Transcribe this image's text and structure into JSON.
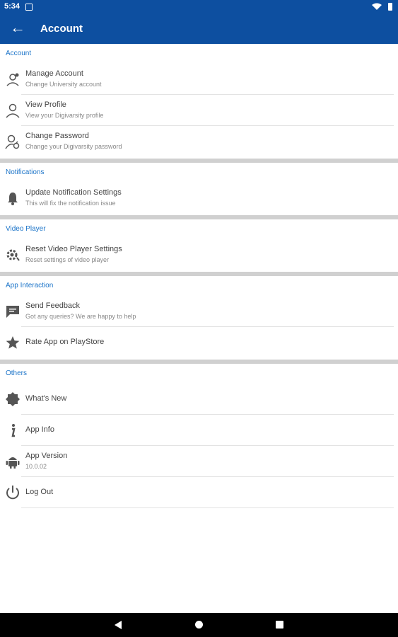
{
  "status_bar": {
    "time": "5:34"
  },
  "app_bar": {
    "title": "Account"
  },
  "sections": {
    "account": {
      "header": "Account",
      "items": [
        {
          "title": "Manage Account",
          "subtitle": "Change University account"
        },
        {
          "title": "View Profile",
          "subtitle": "View your Digivarsity profile"
        },
        {
          "title": "Change Password",
          "subtitle": "Change your Digivarsity password"
        }
      ]
    },
    "notifications": {
      "header": "Notifications",
      "items": [
        {
          "title": "Update Notification Settings",
          "subtitle": "This will fix the notification issue"
        }
      ]
    },
    "video_player": {
      "header": "Video Player",
      "items": [
        {
          "title": "Reset Video Player Settings",
          "subtitle": "Reset settings of video player"
        }
      ]
    },
    "app_interaction": {
      "header": "App Interaction",
      "items": [
        {
          "title": "Send Feedback",
          "subtitle": "Got any queries? We are happy to help"
        },
        {
          "title": "Rate App on PlayStore"
        }
      ]
    },
    "others": {
      "header": "Others",
      "items": [
        {
          "title": "What's New"
        },
        {
          "title": "App Info"
        },
        {
          "title": "App Version",
          "subtitle": "10.0.02"
        },
        {
          "title": "Log Out"
        }
      ]
    }
  },
  "colors": {
    "primary": "#0d4fa0",
    "accent": "#1a73c8",
    "icon": "#555555",
    "separator": "#d0d0d0"
  },
  "icons": [
    "back-arrow",
    "manage-account",
    "person",
    "change-password",
    "bell",
    "settings-gear",
    "feedback",
    "star",
    "badge",
    "info",
    "android",
    "power"
  ]
}
